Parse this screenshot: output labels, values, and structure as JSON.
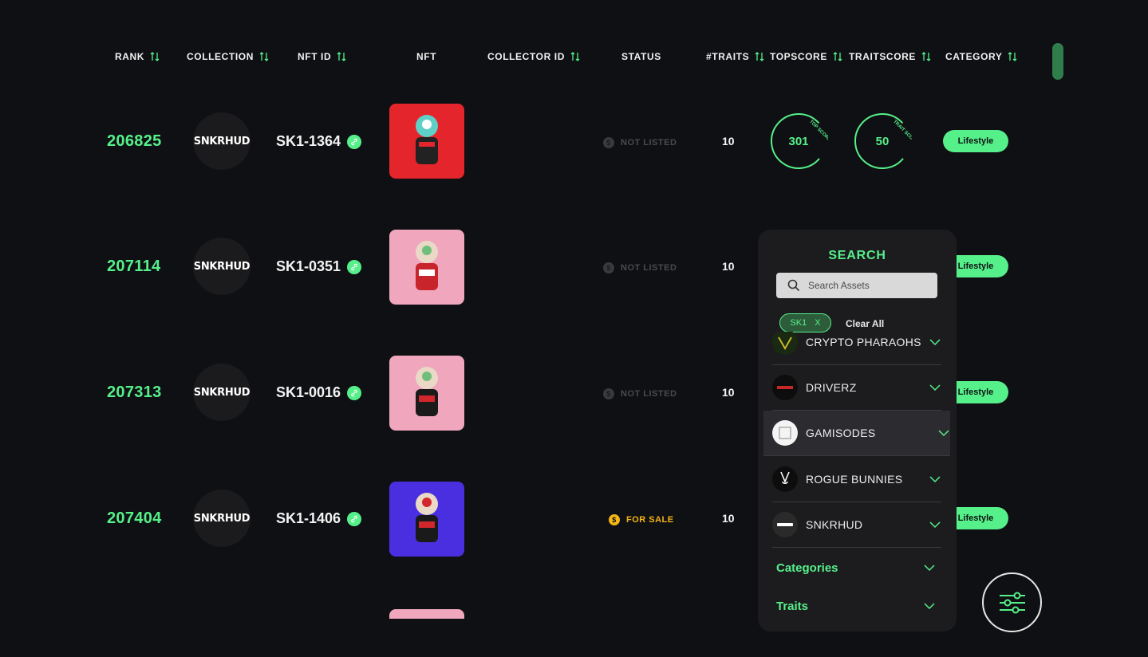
{
  "colors": {
    "accent": "#56f08a",
    "background": "#0f1013",
    "panel": "#1c1c1f",
    "for_sale": "#f5b417",
    "not_listed": "#4a4a4e"
  },
  "table": {
    "headers": {
      "rank": "RANK",
      "collection": "COLLECTION",
      "nft_id": "NFT ID",
      "nft": "NFT",
      "collector_id": "COLLECTOR ID",
      "status": "STATUS",
      "traits": "#TRAITS",
      "topscore": "TOPSCORE",
      "traitscore": "TRAITSCORE",
      "category": "CATEGORY"
    },
    "rows": [
      {
        "rank": "206825",
        "collection_logo": "SNKRHUD",
        "nft_id": "SK1-1364",
        "status": "NOT LISTED",
        "traits": "10",
        "topscore": "301",
        "traitscore": "50",
        "category": "Lifestyle",
        "thumb_bg": "#e4252b",
        "gauge_label_top": "TOP SCORE",
        "gauge_label_trait": "TRAIT SCORE"
      },
      {
        "rank": "207114",
        "collection_logo": "SNKRHUD",
        "nft_id": "SK1-0351",
        "status": "NOT LISTED",
        "traits": "10",
        "category": "Lifestyle",
        "thumb_bg": "#f0a6bc"
      },
      {
        "rank": "207313",
        "collection_logo": "SNKRHUD",
        "nft_id": "SK1-0016",
        "status": "NOT LISTED",
        "traits": "10",
        "category": "Lifestyle",
        "thumb_bg": "#f0a6bc"
      },
      {
        "rank": "207404",
        "collection_logo": "SNKRHUD",
        "nft_id": "SK1-1406",
        "status": "FOR SALE",
        "traits": "10",
        "category": "Lifestyle",
        "thumb_bg": "#4a2fe0"
      }
    ]
  },
  "search_panel": {
    "title": "SEARCH",
    "search_placeholder": "Search Assets",
    "chip_label": "SK1",
    "chip_remove": "X",
    "clear_all": "Clear All",
    "collections": [
      {
        "name": "CRYPTO PHARAOHS"
      },
      {
        "name": "DRIVERZ"
      },
      {
        "name": "GAMISODES"
      },
      {
        "name": "ROGUE BUNNIES"
      },
      {
        "name": "SNKRHUD"
      }
    ],
    "sections": {
      "categories": "Categories",
      "traits": "Traits"
    }
  }
}
